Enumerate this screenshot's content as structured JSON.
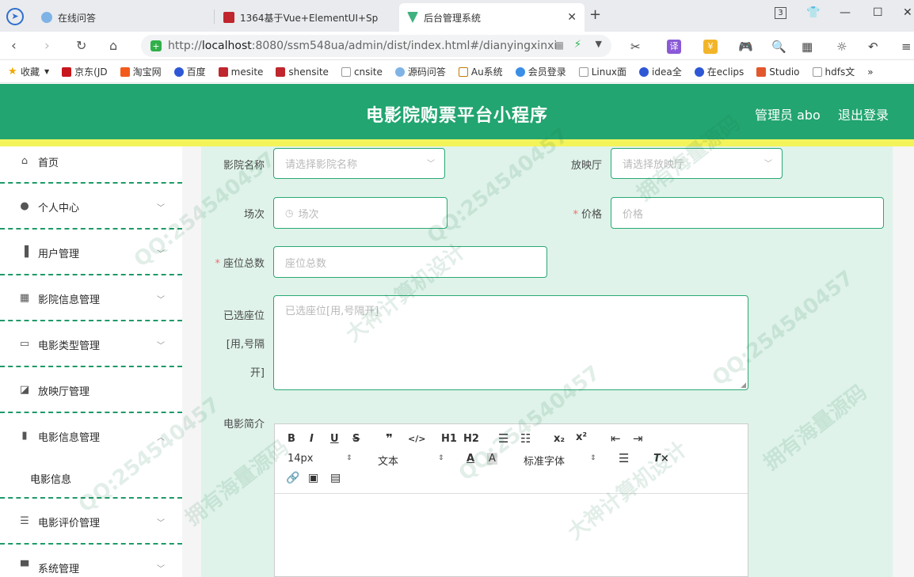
{
  "browser": {
    "tabs": [
      {
        "title": "在线问答"
      },
      {
        "title": "1364基于Vue+ElementUI+Sp"
      },
      {
        "title": "后台管理系统"
      }
    ],
    "tab_count": "3",
    "url_prefix": "http://",
    "url_host": "localhost",
    "url_rest": ":8080/ssm548ua/admin/dist/index.html#/dianyingxinxi",
    "bookmarks": [
      {
        "label": "收藏"
      },
      {
        "label": "京东(JD"
      },
      {
        "label": "淘宝网"
      },
      {
        "label": "百度"
      },
      {
        "label": "mesite"
      },
      {
        "label": "shensite"
      },
      {
        "label": "cnsite"
      },
      {
        "label": "源码问答"
      },
      {
        "label": "Au系统"
      },
      {
        "label": "会员登录"
      },
      {
        "label": "Linux面"
      },
      {
        "label": "idea全"
      },
      {
        "label": "在eclips"
      },
      {
        "label": "Studio"
      },
      {
        "label": "hdfs文"
      }
    ],
    "bookmarks_more": "»"
  },
  "header": {
    "title": "电影院购票平台小程序",
    "admin": "管理员 abo",
    "logout": "退出登录"
  },
  "sidebar": {
    "items": [
      {
        "label": "首页",
        "icon": "home-icon"
      },
      {
        "label": "个人中心",
        "icon": "user-icon"
      },
      {
        "label": "用户管理",
        "icon": "book-icon"
      },
      {
        "label": "影院信息管理",
        "icon": "grid-icon"
      },
      {
        "label": "电影类型管理",
        "icon": "chat-icon"
      },
      {
        "label": "放映厅管理",
        "icon": "chart-icon"
      },
      {
        "label": "电影信息管理",
        "icon": "bar-chart-icon"
      },
      {
        "label": "电影评价管理",
        "icon": "sliders-icon"
      },
      {
        "label": "系统管理",
        "icon": "system-icon"
      }
    ],
    "subitem": "电影信息"
  },
  "form": {
    "cinema_label": "影院名称",
    "cinema_placeholder": "请选择影院名称",
    "hall_label": "放映厅",
    "hall_placeholder": "请选择放映厅",
    "session_label": "场次",
    "session_placeholder": "场次",
    "price_label": "价格",
    "price_placeholder": "价格",
    "seats_label": "座位总数",
    "seats_placeholder": "座位总数",
    "selected_label_1": "已选座位",
    "selected_label_2": "[用,号隔",
    "selected_label_3": "开]",
    "selected_placeholder": "已选座位[用,号隔开]",
    "intro_label": "电影简介"
  },
  "editor": {
    "font_size": "14px",
    "text_type": "文本",
    "font_family": "标准字体",
    "heading1": "H1",
    "heading2": "H2"
  },
  "watermarks": [
    "QQ:254540457",
    "拥有海量源码",
    "大神计算机设计"
  ]
}
